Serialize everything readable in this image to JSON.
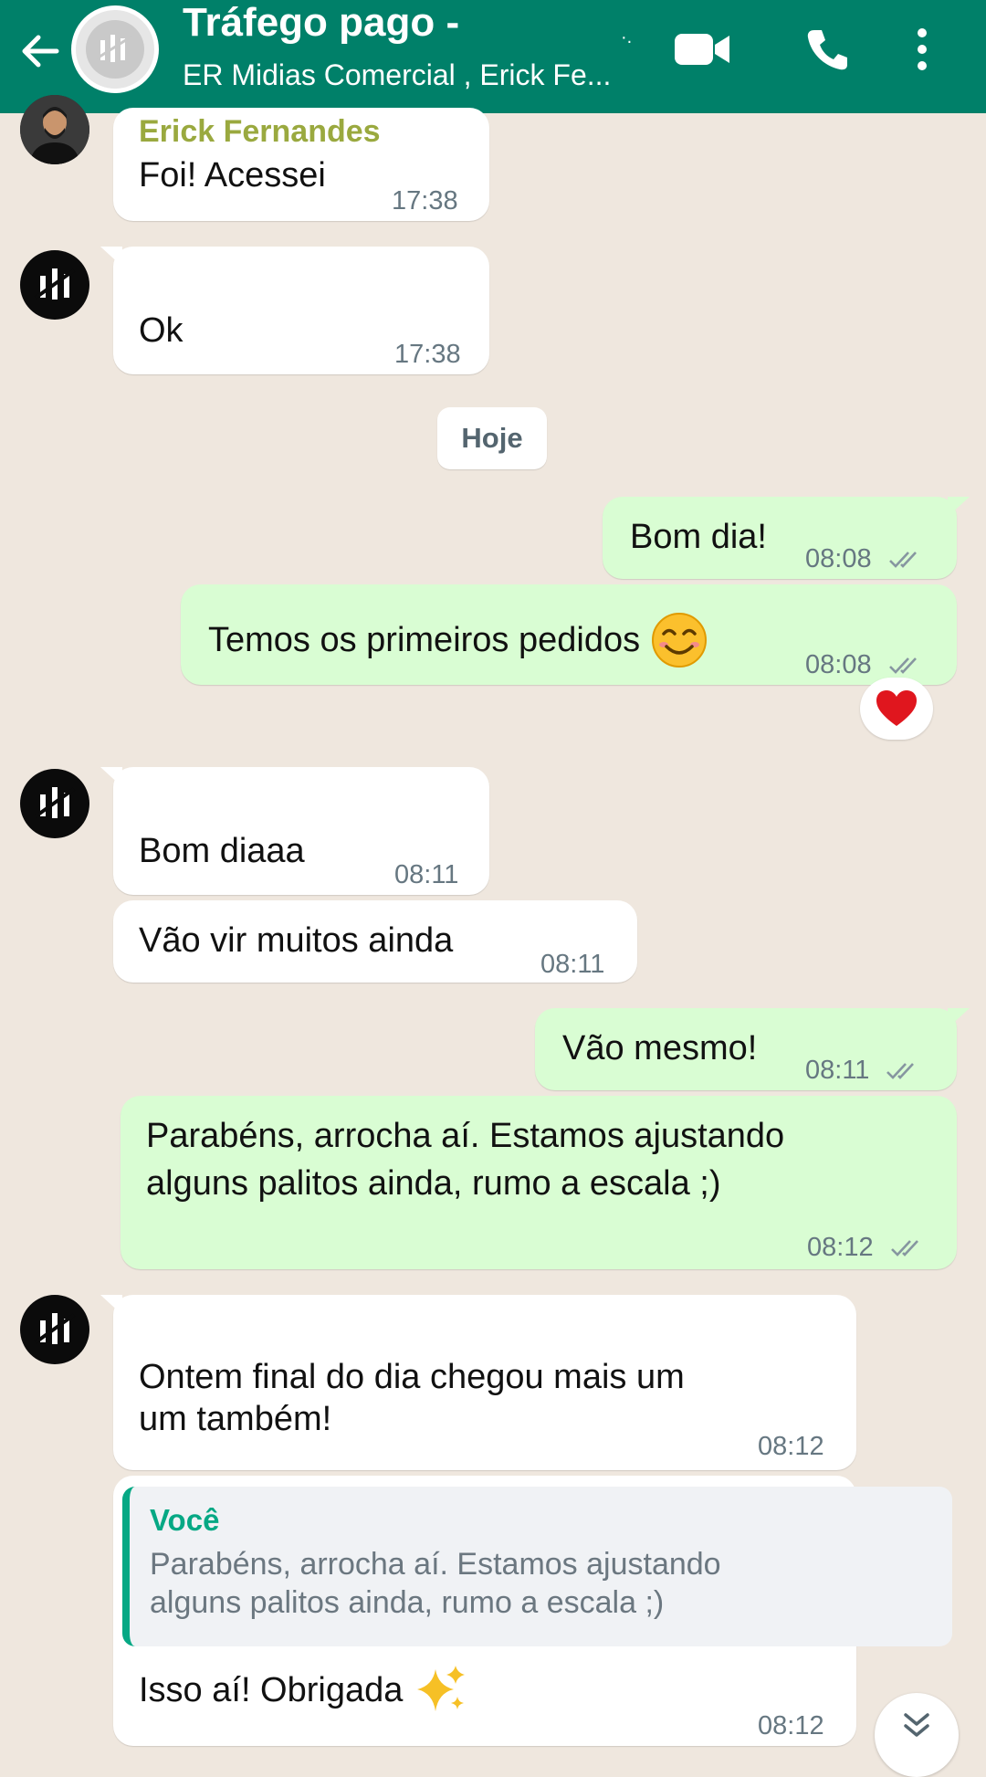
{
  "header": {
    "title": "Tráfego pago -",
    "subtitle": "ER Midias Comercial , Erick Fe...",
    "indicator": "·.",
    "accent": "#008069"
  },
  "icons": [
    "back-arrow-icon",
    "video-call-icon",
    "phone-icon",
    "more-options-icon",
    "heart-icon",
    "smiling-face-emoji",
    "sparkles-emoji",
    "double-check-icon",
    "chevron-double-down-icon"
  ],
  "date_separator": "Hoje",
  "messages": [
    {
      "direction": "in",
      "sender": "Erick Fernandes",
      "text": "Foi! Acessei",
      "time": "17:38"
    },
    {
      "direction": "in",
      "text": "Ok",
      "time": "17:38"
    },
    {
      "direction": "out",
      "text": "Bom dia!",
      "time": "08:08"
    },
    {
      "direction": "out",
      "text": "Temos os primeiros pedidos",
      "emoji": "😊",
      "time": "08:08",
      "reaction": "❤"
    },
    {
      "direction": "in",
      "text": "Bom diaaa",
      "time": "08:11"
    },
    {
      "direction": "in",
      "text": "Vão vir muitos ainda",
      "time": "08:11"
    },
    {
      "direction": "out",
      "text": "Vão mesmo!",
      "time": "08:11"
    },
    {
      "direction": "out",
      "text_lines": [
        "Parabéns, arrocha aí. Estamos ajustando",
        "alguns palitos ainda, rumo a escala ;)"
      ],
      "time": "08:12"
    },
    {
      "direction": "in",
      "text_lines": [
        "Ontem final do dia chegou mais um",
        "um também!"
      ],
      "time": "08:12"
    },
    {
      "direction": "in",
      "quote": {
        "author": "Você",
        "lines": [
          "Parabéns, arrocha aí. Estamos ajustando",
          "alguns palitos ainda, rumo a escala ;)"
        ]
      },
      "text": "Isso aí! Obrigada",
      "emoji": "✨",
      "time": "08:12"
    }
  ]
}
